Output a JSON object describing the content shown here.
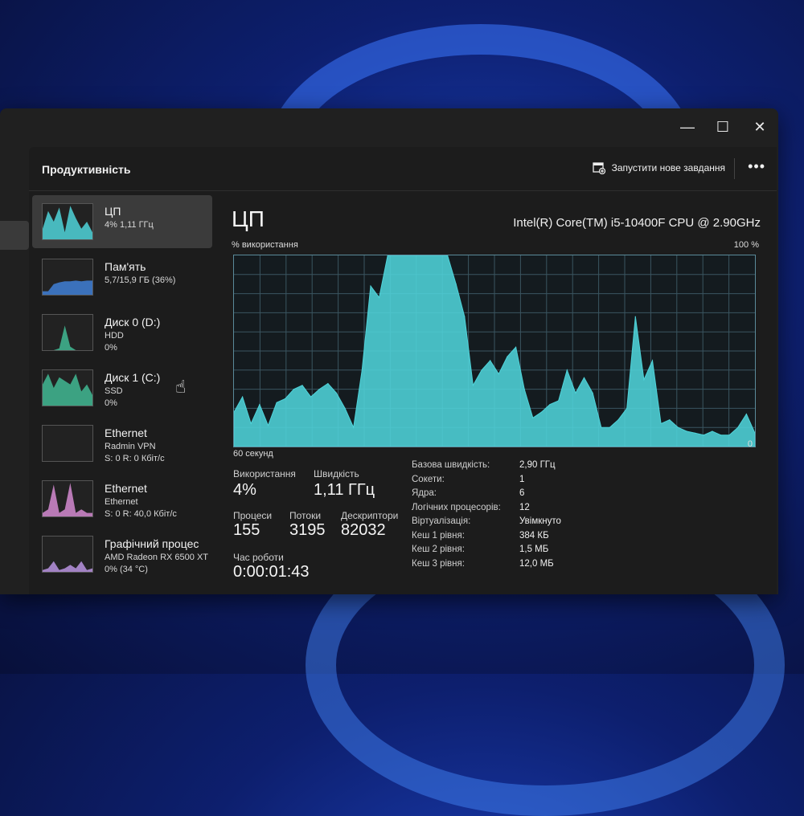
{
  "window": {
    "minimize": "—",
    "maximize": "☐",
    "close": "✕"
  },
  "header": {
    "title": "Продуктивність",
    "run_task": "Запустити нове завдання",
    "more": "•••"
  },
  "sidebar": {
    "items": [
      {
        "name": "ЦП",
        "sub1": "4% 1,11 ГГц",
        "sub2": "",
        "selected": true,
        "color": "#4fd3d9"
      },
      {
        "name": "Пам'ять",
        "sub1": "5,7/15,9 ГБ (36%)",
        "sub2": "",
        "color": "#3f7fd6"
      },
      {
        "name": "Диск 0 (D:)",
        "sub1": "HDD",
        "sub2": "0%",
        "color": "#41b893"
      },
      {
        "name": "Диск 1 (C:)",
        "sub1": "SSD",
        "sub2": "0%",
        "color": "#41b893"
      },
      {
        "name": "Ethernet",
        "sub1": "Radmin VPN",
        "sub2": "S: 0 R: 0 Кбіт/с",
        "color": "#d38ad0"
      },
      {
        "name": "Ethernet",
        "sub1": "Ethernet",
        "sub2": "S: 0 R: 40,0 Кбіт/с",
        "color": "#d38ad0"
      },
      {
        "name": "Графічний процес",
        "sub1": "AMD Radeon RX 6500 XT",
        "sub2": "0% (34 °C)",
        "color": "#b893e0"
      }
    ]
  },
  "main": {
    "title": "ЦП",
    "cpu_model": "Intel(R) Core(TM) i5-10400F CPU @ 2.90GHz",
    "y_label": "% використання",
    "y_max": "100 %",
    "x_label": "60 секунд",
    "x_min": "0"
  },
  "stats": {
    "usage_label": "Використання",
    "usage_value": "4%",
    "speed_label": "Швидкість",
    "speed_value": "1,11 ГГц",
    "processes_label": "Процеси",
    "processes_value": "155",
    "threads_label": "Потоки",
    "threads_value": "3195",
    "handles_label": "Дескриптори",
    "handles_value": "82032",
    "uptime_label": "Час роботи",
    "uptime_value": "0:00:01:43"
  },
  "specs": [
    {
      "key": "Базова швидкість:",
      "value": "2,90 ГГц"
    },
    {
      "key": "Сокети:",
      "value": "1"
    },
    {
      "key": "Ядра:",
      "value": "6"
    },
    {
      "key": "Логічних процесорів:",
      "value": "12"
    },
    {
      "key": "Віртуалізація:",
      "value": "Увімкнуто"
    },
    {
      "key": "Кеш 1 рівня:",
      "value": "384 КБ"
    },
    {
      "key": "Кеш 2 рівня:",
      "value": "1,5 МБ"
    },
    {
      "key": "Кеш 3 рівня:",
      "value": "12,0 МБ"
    }
  ],
  "chart_data": {
    "type": "area",
    "x_range": [
      60,
      0
    ],
    "ylim": [
      0,
      100
    ],
    "grid": true,
    "color": "#4fd3d9",
    "values": [
      18,
      26,
      12,
      22,
      11,
      23,
      25,
      30,
      32,
      26,
      30,
      33,
      28,
      20,
      10,
      40,
      84,
      78,
      100,
      100,
      100,
      100,
      100,
      100,
      100,
      100,
      85,
      68,
      32,
      40,
      45,
      38,
      47,
      52,
      30,
      15,
      18,
      22,
      24,
      40,
      28,
      36,
      28,
      10,
      10,
      14,
      20,
      68,
      35,
      45,
      12,
      14,
      10,
      8,
      7,
      6,
      8,
      6,
      6,
      10,
      17,
      7
    ]
  }
}
